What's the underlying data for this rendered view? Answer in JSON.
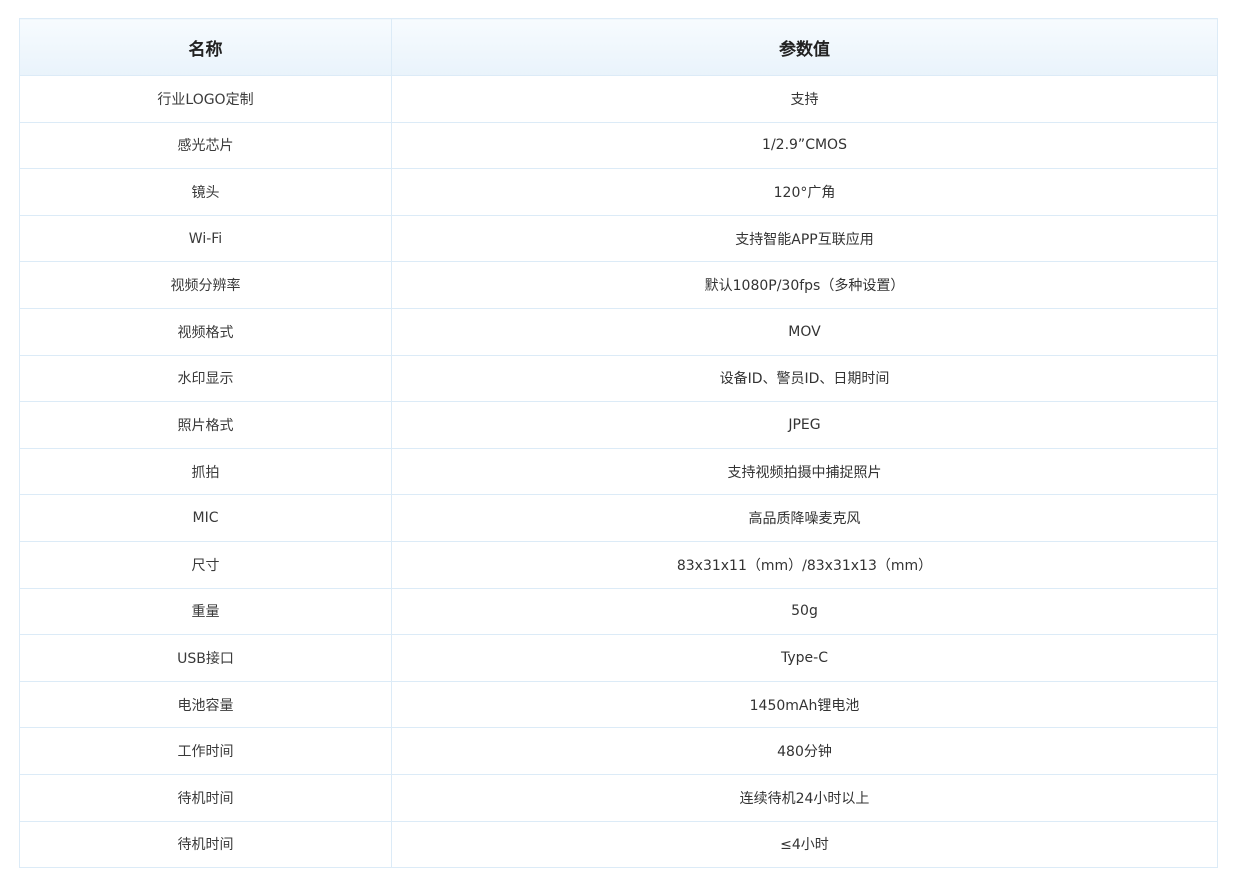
{
  "table": {
    "headers": [
      "名称",
      "参数值"
    ],
    "rows": [
      [
        "行业LOGO定制",
        "支持"
      ],
      [
        "感光芯片",
        "1/2.9”CMOS"
      ],
      [
        "镜头",
        "120°广角"
      ],
      [
        "Wi-Fi",
        "支持智能APP互联应用"
      ],
      [
        "视频分辨率",
        "默认1080P/30fps（多种设置）"
      ],
      [
        "视频格式",
        "MOV"
      ],
      [
        "水印显示",
        "设备ID、警员ID、日期时间"
      ],
      [
        "照片格式",
        "JPEG"
      ],
      [
        "抓拍",
        "支持视频拍摄中捕捉照片"
      ],
      [
        "MIC",
        "高品质降噪麦克风"
      ],
      [
        "尺寸",
        "83x31x11（mm）/83x31x13（mm）"
      ],
      [
        "重量",
        "50g"
      ],
      [
        "USB接口",
        "Type-C"
      ],
      [
        "电池容量",
        "1450mAh锂电池"
      ],
      [
        "工作时间",
        "480分钟"
      ],
      [
        "待机时间",
        "连续待机24小时以上"
      ],
      [
        "待机时间",
        "≤4小时"
      ]
    ]
  }
}
